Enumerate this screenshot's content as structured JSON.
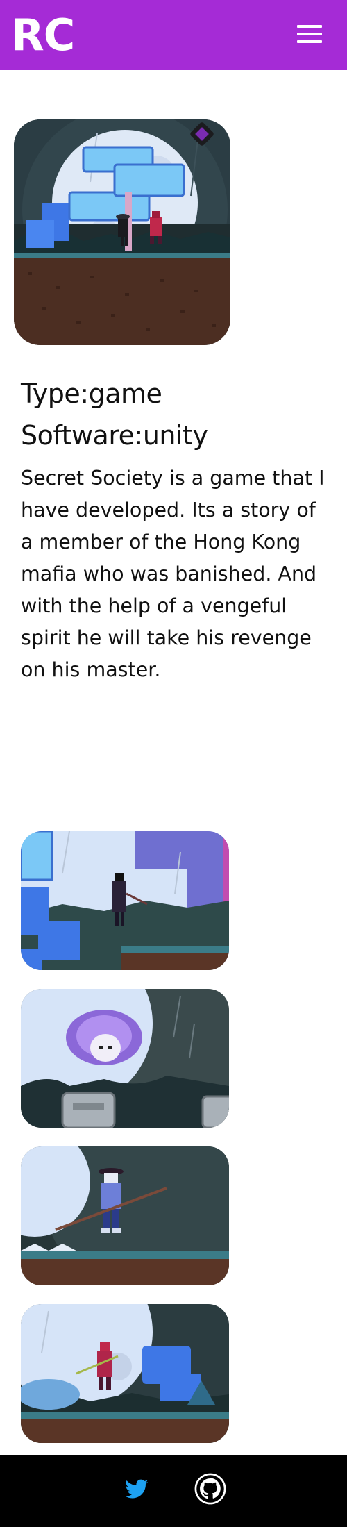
{
  "header": {
    "logo": "RC",
    "menu_icon": "hamburger-menu-icon",
    "background_color": "#a52bd6"
  },
  "project": {
    "cover_image": "secret-society-cover-screenshot",
    "type_line": "Type:game",
    "software_line": "Software:unity",
    "description": "Secret Society is a game that I have developed. Its a story of a member of the Hong Kong mafia who was banished. And with the help of a vengeful spirit he will take his revenge on his master."
  },
  "gallery": [
    {
      "image": "gameplay-ninja-graveyard"
    },
    {
      "image": "gameplay-vengeful-spirit"
    },
    {
      "image": "gameplay-spearman-enemy"
    },
    {
      "image": "gameplay-demon-moonlight"
    }
  ],
  "footer": {
    "background_color": "#000000",
    "links": [
      {
        "icon": "twitter-icon",
        "color": "#1da1f2"
      },
      {
        "icon": "github-icon",
        "color": "#ffffff"
      }
    ]
  }
}
